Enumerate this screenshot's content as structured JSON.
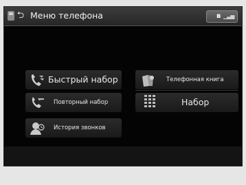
{
  "header": {
    "title": "Меню телефона",
    "back_symbol": "⮌",
    "bluetooth_symbol": "ʙ",
    "signal_symbol": "▁▃▅"
  },
  "menu": {
    "speed_dial": "Быстрый набор",
    "redial": "Повторный набор",
    "call_history": "История звонков",
    "phonebook": "Телефонная книга",
    "dial": "Набор"
  },
  "colors": {
    "accent": "#cfcfcf",
    "background": "#040404",
    "text": "#e8e8e8"
  }
}
